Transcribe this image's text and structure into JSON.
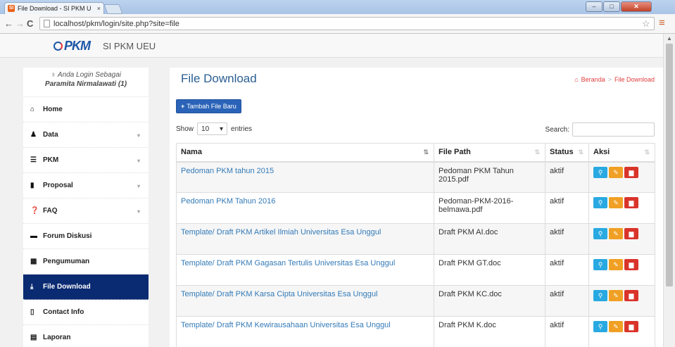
{
  "browser": {
    "tab_title": "File Download - SI PKM U",
    "tab_close": "×",
    "favicon": "SI",
    "url": "localhost/pkm/login/site.php?site=file",
    "win_min": "–",
    "win_max": "□",
    "win_close": "✕",
    "back_icon": "←",
    "forward_icon": "→",
    "reload_icon": "C",
    "star_icon": "☆",
    "menu_icon": "≡"
  },
  "header": {
    "logo_text": "PKM",
    "brand": "SI PKM UEU"
  },
  "sidebar": {
    "login_label": "Anda Login Sebagai",
    "login_user": "Paramita Nirmalawati (1)",
    "items": [
      {
        "label": "Home",
        "icon": "⌂",
        "has_caret": false
      },
      {
        "label": "Data",
        "icon": "♟",
        "has_caret": true
      },
      {
        "label": "PKM",
        "icon": "☰",
        "has_caret": true
      },
      {
        "label": "Proposal",
        "icon": "▮",
        "has_caret": true
      },
      {
        "label": "FAQ",
        "icon": "❓",
        "has_caret": true
      },
      {
        "label": "Forum Diskusi",
        "icon": "▬",
        "has_caret": false
      },
      {
        "label": "Pengumuman",
        "icon": "▦",
        "has_caret": false
      },
      {
        "label": "File Download",
        "icon": "⤓",
        "has_caret": false,
        "active": true
      },
      {
        "label": "Contact Info",
        "icon": "▯",
        "has_caret": false
      },
      {
        "label": "Laporan",
        "icon": "▤",
        "has_caret": false
      }
    ],
    "caret": "▾"
  },
  "main": {
    "title": "File Download",
    "breadcrumb": {
      "home": "Beranda",
      "sep": ">",
      "current": "File Download"
    },
    "add_button": "Tambah File Baru",
    "show_label": "Show",
    "show_value": "10",
    "entries_label": "entries",
    "search_label": "Search:",
    "search_value": ""
  },
  "table": {
    "columns": [
      "Nama",
      "File Path",
      "Status",
      "Aksi"
    ],
    "rows": [
      {
        "nama": "Pedoman PKM tahun 2015",
        "path": "Pedoman PKM Tahun 2015.pdf",
        "status": "aktif"
      },
      {
        "nama": "Pedoman PKM Tahun 2016",
        "path": "Pedoman-PKM-2016-belmawa.pdf",
        "status": "aktif"
      },
      {
        "nama": "Template/ Draft PKM Artikel Ilmiah Universitas Esa Unggul",
        "path": "Draft PKM AI.doc",
        "status": "aktif"
      },
      {
        "nama": "Template/ Draft PKM Gagasan Tertulis Universitas Esa Unggul",
        "path": "Draft PKM GT.doc",
        "status": "aktif"
      },
      {
        "nama": "Template/ Draft PKM Karsa Cipta Universitas Esa Unggul",
        "path": "Draft PKM KC.doc",
        "status": "aktif"
      },
      {
        "nama": "Template/ Draft PKM Kewirausahaan Universitas Esa Unggul",
        "path": "Draft PKM K.doc",
        "status": "aktif"
      }
    ],
    "icons": {
      "view": "⚲",
      "edit": "✎",
      "delete": "▆"
    }
  },
  "colors": {
    "brand_blue": "#1d57a6",
    "active_nav": "#0a2a72",
    "link": "#337ab7",
    "btn_view": "#29a9e1",
    "btn_edit": "#f0a024",
    "btn_delete": "#d9342a"
  }
}
